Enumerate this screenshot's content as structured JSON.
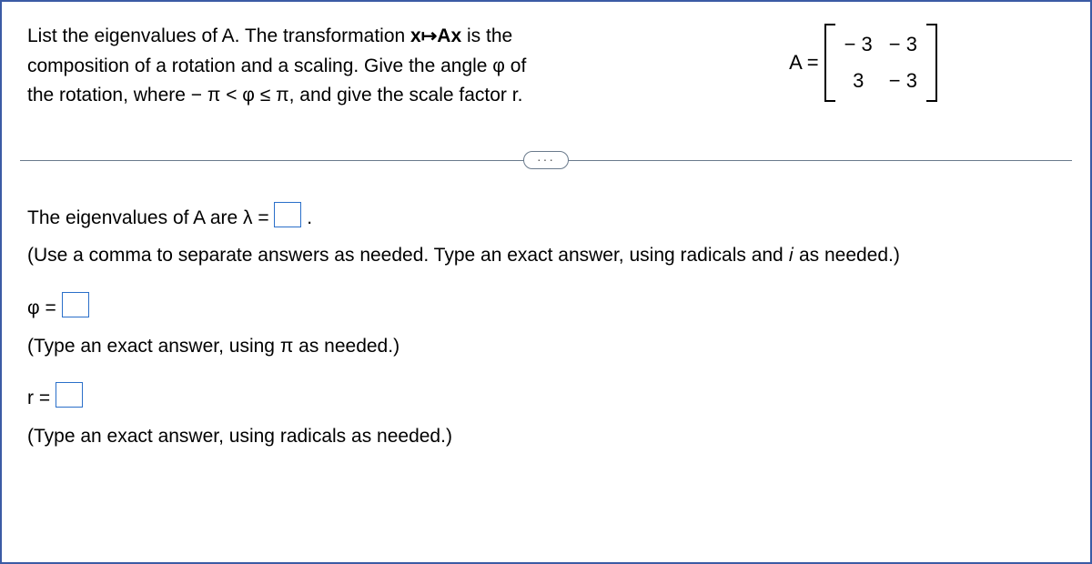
{
  "prompt": {
    "line1_pre": "List the eigenvalues of A. The transformation ",
    "map_bold": "x↦Ax",
    "line1_post": " is the",
    "line2": "composition of a rotation and a scaling. Give the angle φ of",
    "line3": "the rotation, where   − π < φ ≤ π, and give the scale factor r."
  },
  "matrix": {
    "label": "A =",
    "a11": "− 3",
    "a12": "− 3",
    "a21": "3",
    "a22": "− 3"
  },
  "expander": "···",
  "answers": {
    "lambda_pre": "The eigenvalues of A are λ =",
    "lambda_post": ".",
    "lambda_hint": "(Use a comma to separate answers as needed. Type an exact answer, using radicals and 𝑖 as needed.)",
    "phi_label": "φ =",
    "phi_hint": "(Type an exact answer, using π as needed.)",
    "r_label": "r =",
    "r_hint": "(Type an exact answer, using radicals as needed.)"
  }
}
